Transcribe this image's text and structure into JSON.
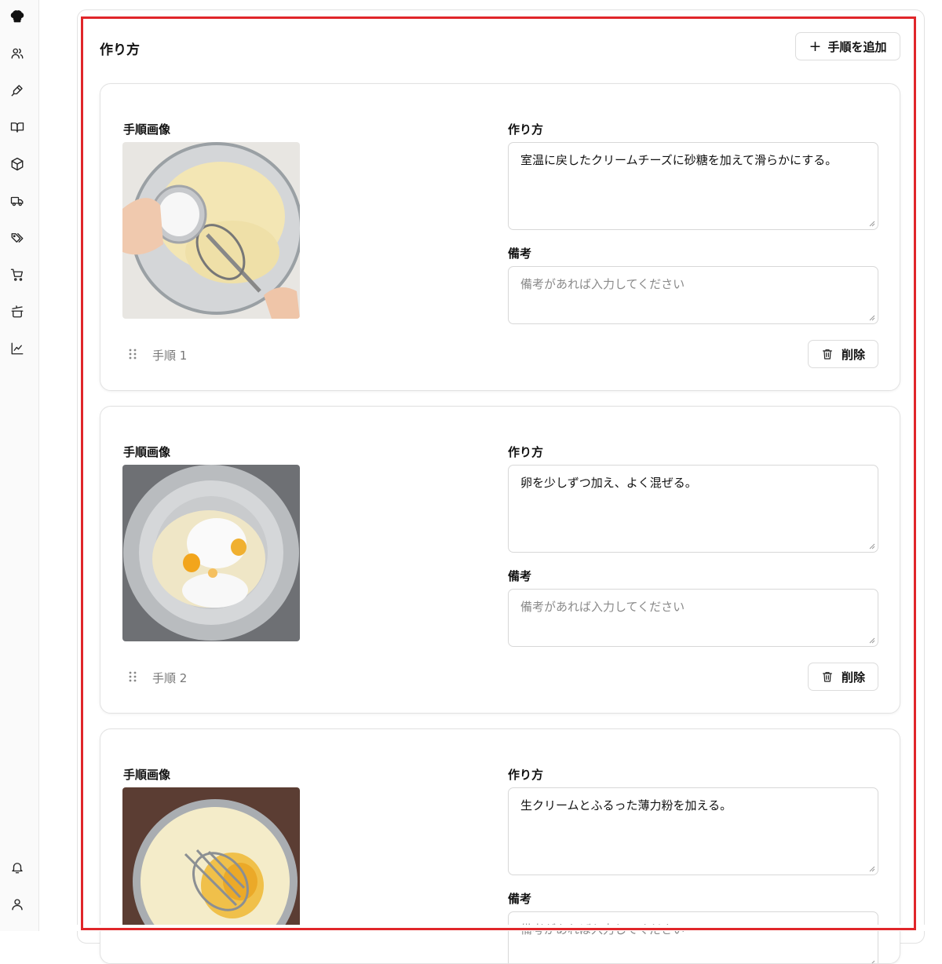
{
  "nav": {
    "items": [
      "chef-hat-icon",
      "users-icon",
      "pen-icon",
      "book-icon",
      "package-icon",
      "truck-icon",
      "tags-icon",
      "cart-icon",
      "cooking-pot-icon",
      "chart-icon"
    ],
    "bottom": [
      "bell-icon",
      "user-icon"
    ]
  },
  "section": {
    "title": "作り方",
    "add_label": "手順を追加"
  },
  "labels": {
    "image": "手順画像",
    "method": "作り方",
    "note": "備考"
  },
  "steps": [
    {
      "method": "室温に戻したクリームチーズに砂糖を加えて滑らかにする。",
      "note_placeholder": "備考があれば入力してください",
      "step_label": "手順 1",
      "delete_label": "削除"
    },
    {
      "method": "卵を少しずつ加え、よく混ぜる。",
      "note_placeholder": "備考があれば入力してください",
      "step_label": "手順 2",
      "delete_label": "削除"
    },
    {
      "method": "生クリームとふるった薄力粉を加える。",
      "note_placeholder": "備考があれば入力してください"
    }
  ],
  "colors": {
    "highlight": "#e0262a"
  }
}
